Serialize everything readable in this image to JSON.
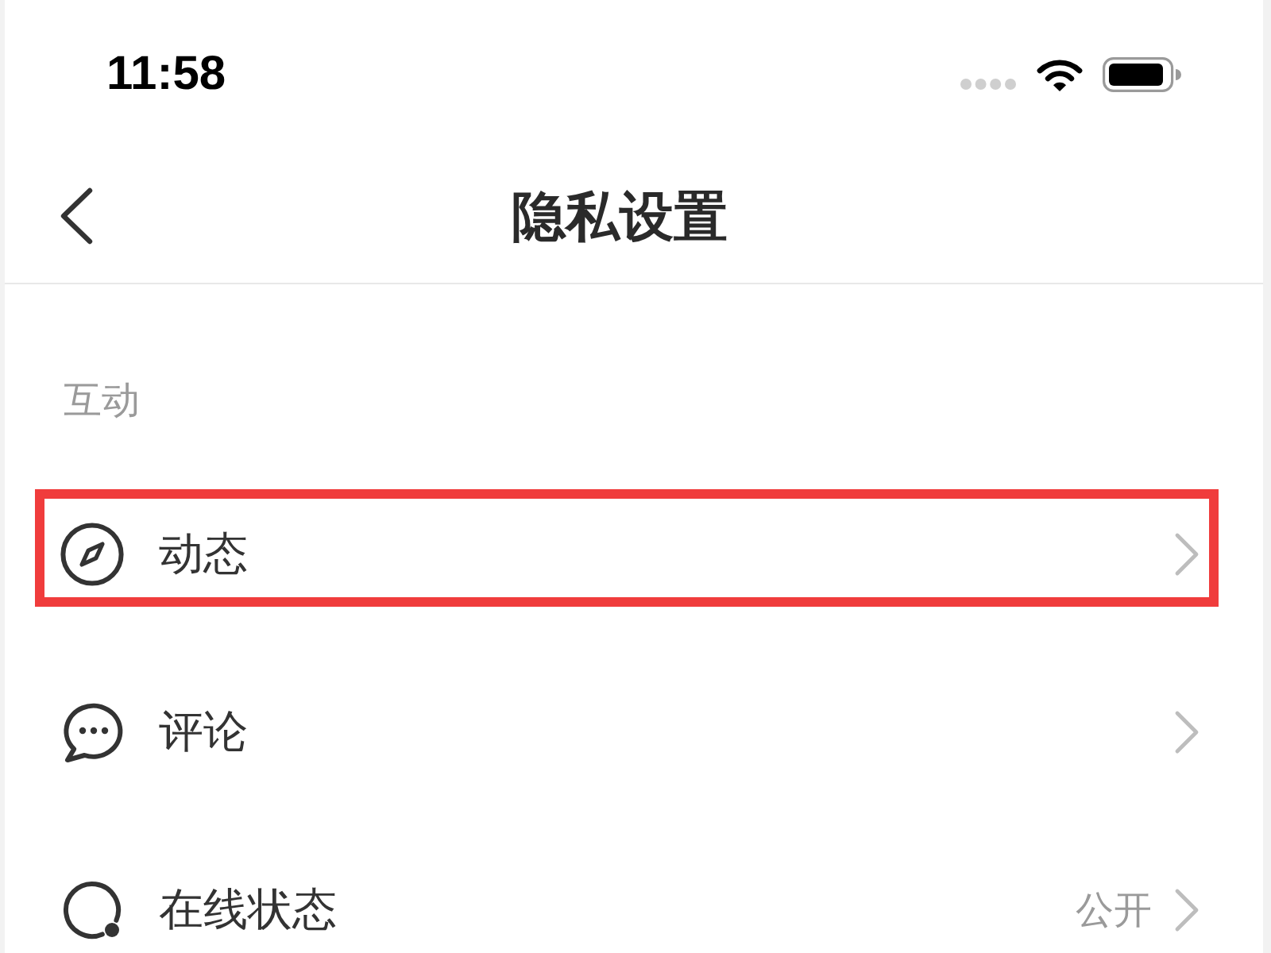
{
  "status_bar": {
    "time": "11:58"
  },
  "nav_bar": {
    "title": "隐私设置"
  },
  "sections": [
    {
      "header": "互动",
      "items": [
        {
          "label": "动态",
          "highlighted": true
        },
        {
          "label": "评论",
          "highlighted": false
        },
        {
          "label": "在线状态",
          "value": "公开",
          "highlighted": false
        }
      ]
    }
  ]
}
